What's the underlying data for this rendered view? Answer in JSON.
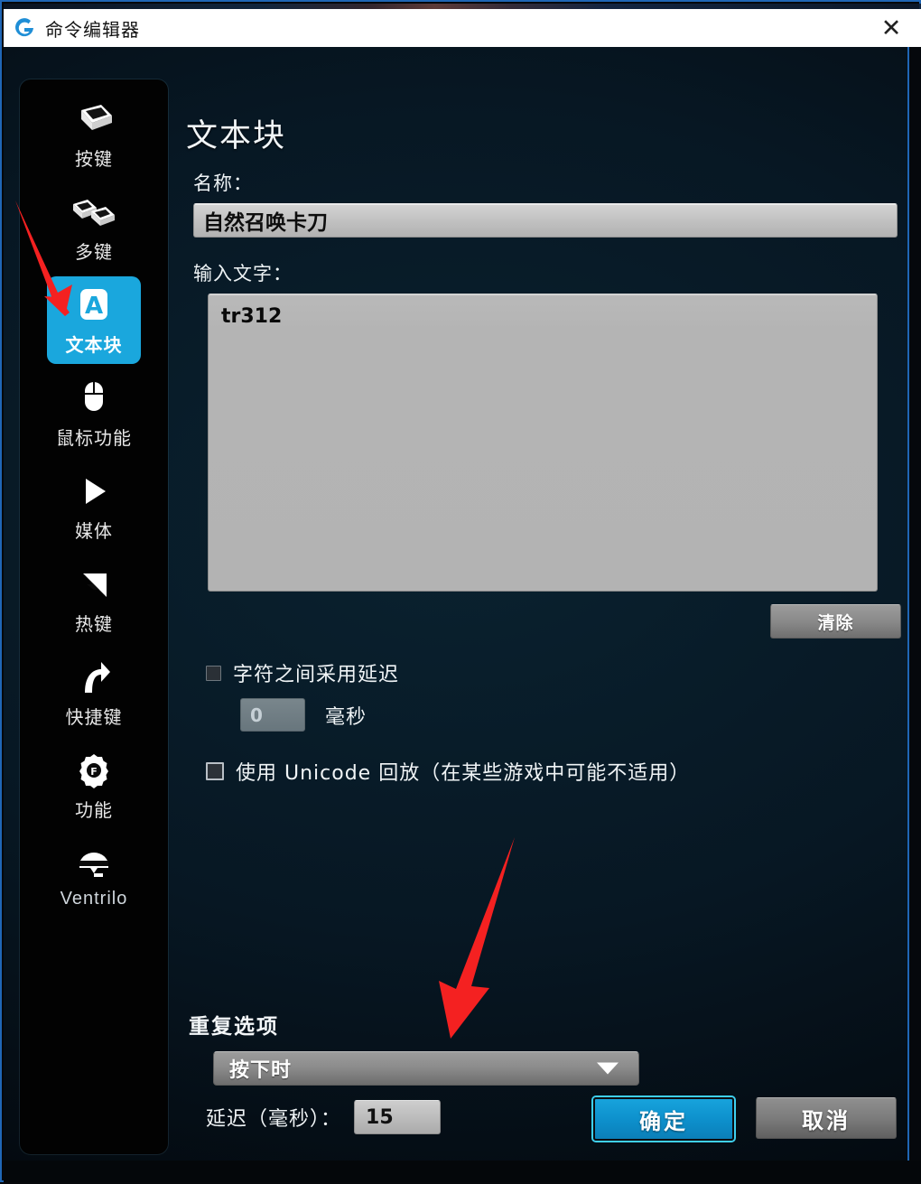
{
  "window": {
    "title": "命令编辑器",
    "logo_icon": "logitech-g-logo-icon",
    "close_icon": "✕"
  },
  "sidebar": {
    "items": [
      {
        "label": "按键",
        "icon": "single-keycap-icon",
        "active": false
      },
      {
        "label": "多键",
        "icon": "multi-keycap-icon",
        "active": false
      },
      {
        "label": "文本块",
        "icon": "letter-a-block-icon",
        "active": true
      },
      {
        "label": "鼠标功能",
        "icon": "mouse-icon",
        "active": false
      },
      {
        "label": "媒体",
        "icon": "play-triangle-icon",
        "active": false
      },
      {
        "label": "热键",
        "icon": "lightning-bolt-icon",
        "active": false
      },
      {
        "label": "快捷键",
        "icon": "curved-arrow-icon",
        "active": false
      },
      {
        "label": "功能",
        "icon": "gear-f-icon",
        "active": false
      },
      {
        "label": "Ventrilo",
        "icon": "headset-icon",
        "active": false
      }
    ]
  },
  "main": {
    "page_title": "文本块",
    "name_label": "名称：",
    "name_value": "自然召唤卡刀",
    "text_label": "输入文字：",
    "text_value": "tr312",
    "clear_button": "清除",
    "char_delay_checkbox_label": "字符之间采用延迟",
    "char_delay_checked": false,
    "char_delay_value": "0",
    "char_delay_unit": "毫秒",
    "unicode_checkbox_label": "使用 Unicode 回放（在某些游戏中可能不适用）",
    "unicode_checked": false
  },
  "repeat": {
    "heading": "重复选项",
    "selected_option": "按下时",
    "options": [
      "按下时"
    ],
    "chevron_icon": "chevron-down-icon",
    "delay_label": "延迟（毫秒）：",
    "delay_value": "15"
  },
  "footer": {
    "ok_label": "确定",
    "cancel_label": "取消"
  },
  "annotations": {
    "arrow_1": "red-arrow-icon",
    "arrow_2": "red-arrow-icon"
  },
  "colors": {
    "accent_blue": "#1aa7dd",
    "annotation_red": "#f42121",
    "panel_bg": "#071723",
    "titlebar_bg": "#ffffff"
  }
}
